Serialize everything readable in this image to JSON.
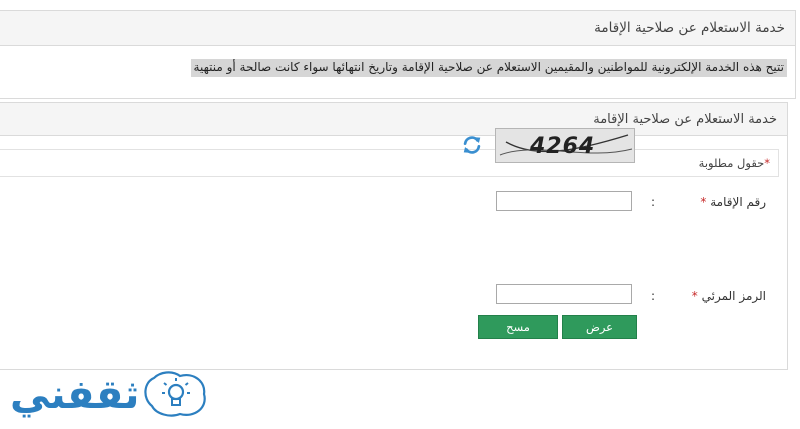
{
  "top_panel": {
    "title": "خدمة الاستعلام عن صلاحية الإقامة",
    "description": "تتيح هذه الخدمة الإلكترونية للمواطنين والمقيمين الاستعلام عن صلاحية الإقامة وتاريخ انتهائها سواء كانت صالحة أو منتهية"
  },
  "form": {
    "title": "خدمة الاستعلام عن صلاحية الإقامة",
    "required_star": "*",
    "required_note": "حقول مطلوبة",
    "iqama_label": "رقم الإقامة",
    "captcha_label": "الرمز المرئي",
    "colon": ":",
    "captcha_text": "4264",
    "iqama_value": "",
    "captcha_value": "",
    "submit_label": "عرض",
    "clear_label": "مسح"
  },
  "logo": {
    "text": "ثقفني"
  },
  "colors": {
    "button": "#2f9a5c",
    "logo": "#2c7fc0",
    "required": "#c62828"
  }
}
